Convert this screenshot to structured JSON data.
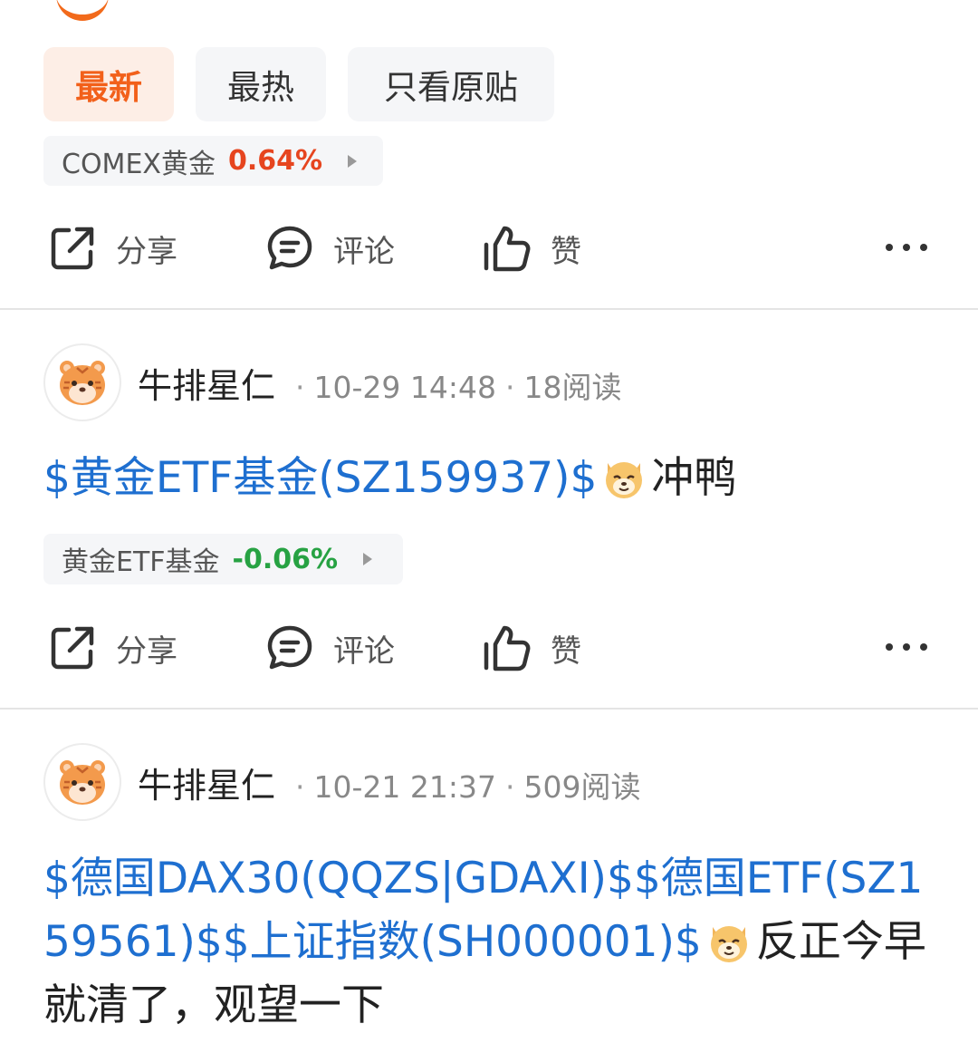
{
  "tabs": [
    "最新",
    "最热",
    "只看原贴"
  ],
  "actions": {
    "share": "分享",
    "comment": "评论",
    "like": "赞"
  },
  "top_tag": {
    "name": "COMEX黄金",
    "change": "0.64%"
  },
  "posts": [
    {
      "author": "牛排星仁",
      "time": "10-29 14:48",
      "reads": "18阅读",
      "link_text": "$黄金ETF基金(SZ159937)$",
      "trailing_text": "冲鸭",
      "tag": {
        "name": "黄金ETF基金",
        "change": "-0.06%"
      }
    },
    {
      "author": "牛排星仁",
      "time": "10-21 21:37",
      "reads": "509阅读",
      "link_text": "$德国DAX30(QQZS|GDAXI)$$德国ETF(SZ159561)$$上证指数(SH000001)$",
      "trailing_text": "反正今早就清了，观望一下"
    }
  ],
  "colors": {
    "accent": "#f2601a",
    "link": "#1e6fd0",
    "up": "#e6451f",
    "down": "#27a243"
  }
}
